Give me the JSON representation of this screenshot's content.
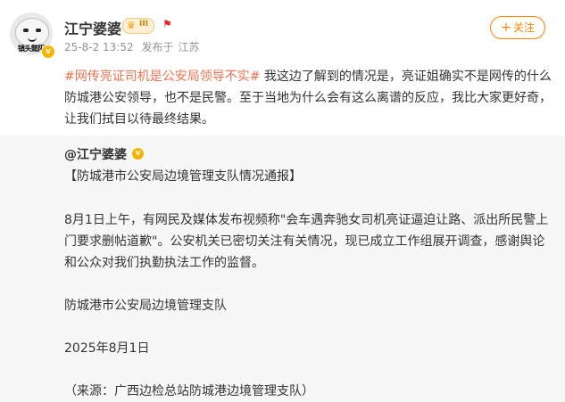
{
  "post": {
    "avatar_caption": "镇头懿阳",
    "username": "江宁婆婆",
    "badge_level": "III",
    "timestamp": "25-8-2 13:52",
    "source_prefix": "发布于",
    "location": "江苏",
    "follow_label": "关注",
    "hashtag": "#网传亮证司机是公安局领导不实#",
    "text": " 我这边了解到的情况是，亮证姐确实不是网传的什么防城港公安领导，也不是民警。至于当地为什么会有这么离谱的反应，我比大家更好奇，让我们拭目以待最终结果。"
  },
  "repost": {
    "author": "@江宁婆婆",
    "title": "【防城港市公安局边境管理支队情况通报】",
    "body": "8月1日上午，有网民及媒体发布视频称\"会车遇奔驰女司机亮证逼迫让路、派出所民警上门要求删帖道歉\"。公安机关已密切关注有关情况，现已成立工作组展开调查，感谢舆论和公众对我们执勤执法工作的监督。",
    "signature": "防城港市公安局边境管理支队",
    "date": "2025年8月1日",
    "source": "（来源：广西边检总站防城港边境管理支队）"
  },
  "colors": {
    "accent_orange": "#ff8200",
    "hashtag": "#eb7350",
    "verify_gold": "#f7b500",
    "meta_gray": "#939393",
    "repost_bg": "#f7f7f7"
  },
  "icons": [
    "verified-icon",
    "crown-icon",
    "flag-icon",
    "plus-icon"
  ]
}
